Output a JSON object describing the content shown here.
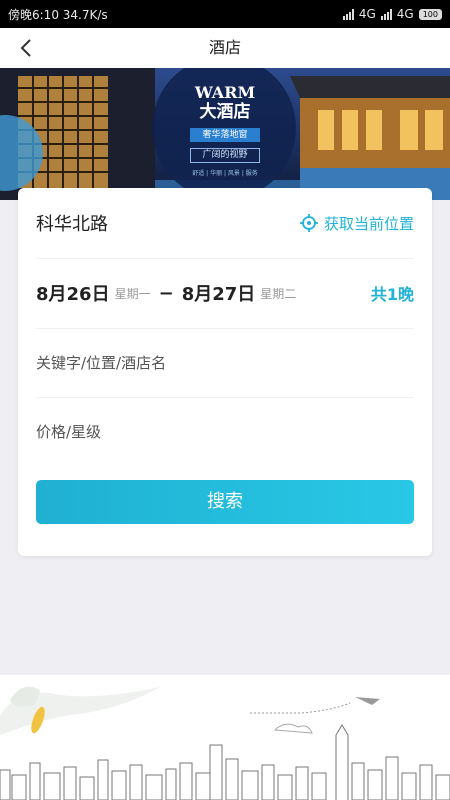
{
  "status": {
    "left": "傍晚6:10 34.7K/s",
    "net1": "4G",
    "net2": "4G",
    "battery": "100"
  },
  "nav": {
    "title": "酒店"
  },
  "banner": {
    "title_en": "WARM",
    "title_cn": "大酒店",
    "tag1": "奢华落地窗",
    "tag2": "广阔的视野",
    "features": "舒适 | 华丽 | 风景 | 服务"
  },
  "form": {
    "city": "科华北路",
    "locate_label": "获取当前位置",
    "checkin_date": "8月26日",
    "checkin_week": "星期一",
    "checkout_date": "8月27日",
    "checkout_week": "星期二",
    "nights": "共1晚",
    "keyword_placeholder": "关键字/位置/酒店名",
    "price_placeholder": "价格/星级",
    "search_label": "搜索"
  },
  "colors": {
    "accent": "#21b3d8",
    "banner_bg": "#1a2a55"
  }
}
